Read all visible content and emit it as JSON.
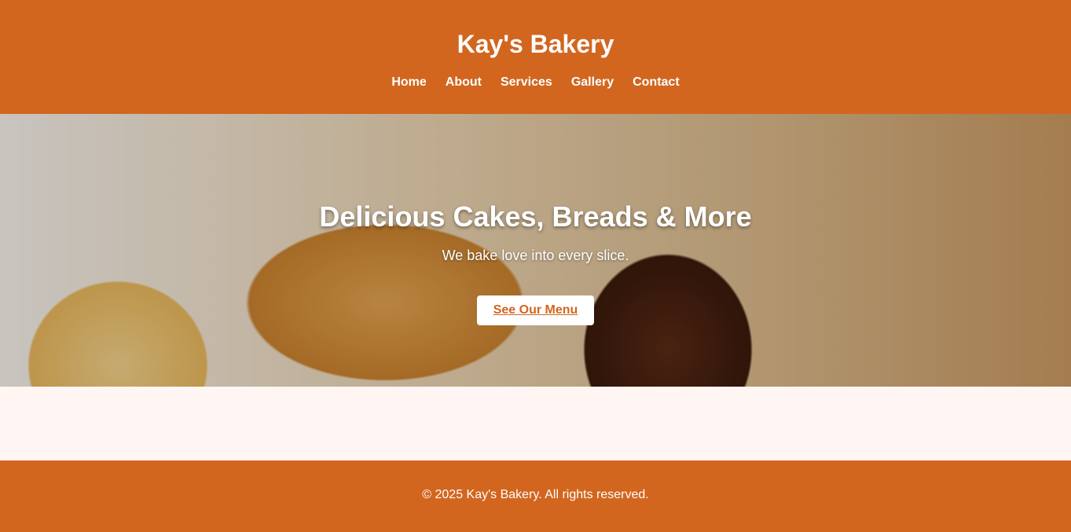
{
  "header": {
    "title": "Kay's Bakery",
    "nav": [
      "Home",
      "About",
      "Services",
      "Gallery",
      "Contact"
    ]
  },
  "hero": {
    "heading": "Delicious Cakes, Breads & More",
    "subheading": "We bake love into every slice.",
    "button": "See Our Menu"
  },
  "footer": {
    "text": "© 2025 Kay's Bakery. All rights reserved."
  },
  "colors": {
    "brand": "#d2661f",
    "background": "#fff6f3"
  }
}
